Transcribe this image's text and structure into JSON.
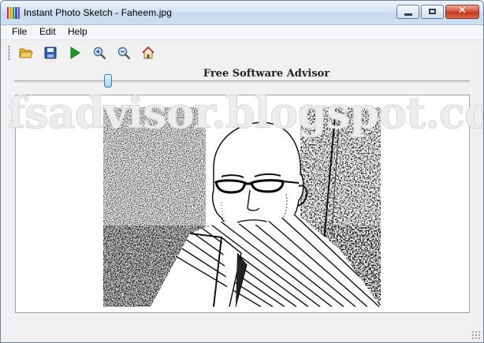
{
  "window": {
    "title": "Instant Photo Sketch - Faheem.jpg"
  },
  "menu": {
    "items": [
      "File",
      "Edit",
      "Help"
    ]
  },
  "toolbar": {
    "buttons": [
      {
        "name": "open-folder-icon"
      },
      {
        "name": "save-disk-icon"
      },
      {
        "name": "play-icon"
      },
      {
        "name": "zoom-in-icon"
      },
      {
        "name": "zoom-out-icon"
      },
      {
        "name": "home-icon"
      }
    ]
  },
  "header": {
    "label": "Free Software Advisor"
  },
  "slider": {
    "value_fraction": 0.2
  },
  "watermark": {
    "text": "fsadvisor.blogspot.com"
  },
  "colors": {
    "titlebar": "#d6e5f4",
    "close": "#c23b22",
    "accent": "#3a7fb6"
  }
}
